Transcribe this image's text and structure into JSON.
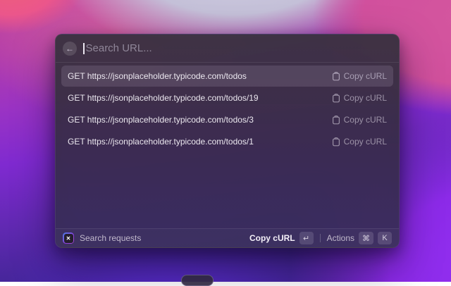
{
  "search": {
    "placeholder": "Search URL...",
    "value": ""
  },
  "icons": {
    "back_glyph": "←",
    "extension_glyph": "✕",
    "row_action_icon": "clipboard-icon"
  },
  "list": {
    "rows": [
      {
        "text": "GET https://jsonplaceholder.typicode.com/todos",
        "action": "Copy cURL",
        "selected": true
      },
      {
        "text": "GET https://jsonplaceholder.typicode.com/todos/19",
        "action": "Copy cURL",
        "selected": false
      },
      {
        "text": "GET https://jsonplaceholder.typicode.com/todos/3",
        "action": "Copy cURL",
        "selected": false
      },
      {
        "text": "GET https://jsonplaceholder.typicode.com/todos/1",
        "action": "Copy cURL",
        "selected": false
      }
    ]
  },
  "footer": {
    "command_name": "Search requests",
    "primary_action": "Copy cURL",
    "primary_key": "↵",
    "actions_label": "Actions",
    "keys": [
      "⌘",
      "K"
    ]
  },
  "colors": {
    "selection_bg": "#56485D",
    "window_tint_top": "#3A3240",
    "window_tint_bottom": "#382E58",
    "wallpaper_pink": "#C2439C",
    "wallpaper_violet": "#8C2AE6",
    "wallpaper_lavender": "#C4C0D8",
    "wallpaper_coral": "#EE5F79",
    "row_text": "#EBE7EF",
    "muted_text": "#9C92A7"
  }
}
